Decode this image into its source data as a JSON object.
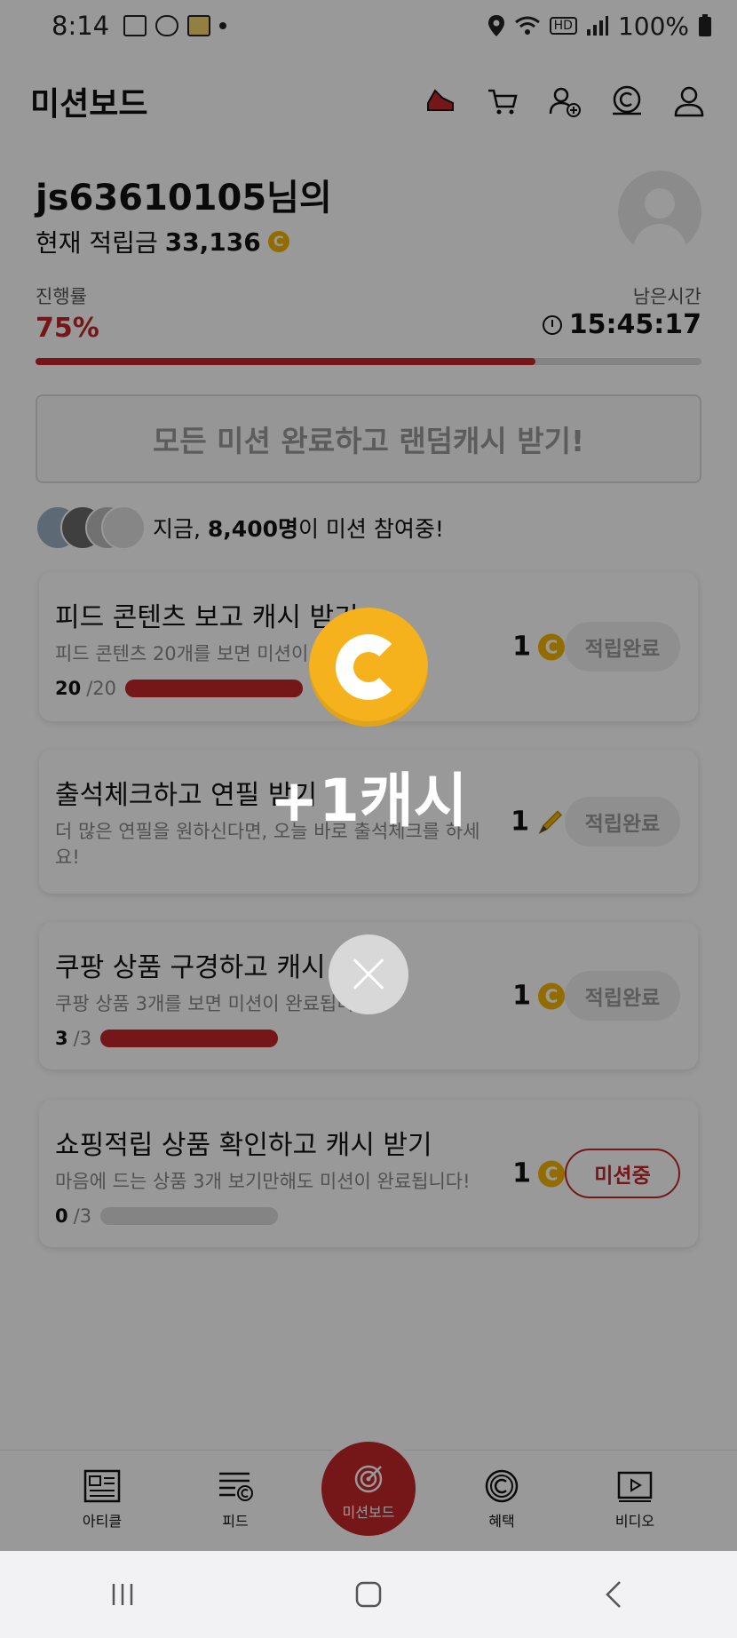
{
  "status_bar": {
    "time": "8:14",
    "battery": "100%",
    "hd_badge": "HD"
  },
  "header": {
    "title": "미션보드",
    "icons": [
      "shoe-icon",
      "cart-icon",
      "add-user-icon",
      "coin-cash-icon",
      "profile-icon"
    ]
  },
  "user": {
    "name": "js63610105님의",
    "balance_label": "현재 적립금",
    "balance_value": "33,136",
    "coin_symbol": "C"
  },
  "progress": {
    "label": "진행률",
    "percent": "75%",
    "percent_value": 0.75,
    "remaining_label": "남은시간",
    "remaining_time": "15:45:17"
  },
  "random_box": {
    "text": "모든 미션 완료하고 랜덤캐시 받기!"
  },
  "participants": {
    "prefix": "지금,",
    "count": "8,400명",
    "suffix": "이 미션 참여중!"
  },
  "missions": [
    {
      "title": "피드 콘텐츠 보고 캐시 받기",
      "desc": "피드 콘텐츠 20개를 보면 미션이 완료됩니다!",
      "done_count": "20",
      "total": "/20",
      "fraction": 1.0,
      "reward": "1",
      "reward_icon": "coin-icon",
      "status": "적립완료"
    },
    {
      "title": "출석체크하고 연필 받기",
      "desc": "더 많은 연필을 원하신다면, 오늘 바로 출석체크를 하세요!",
      "reward": "1",
      "reward_icon": "pencil-icon",
      "status": "적립완료"
    },
    {
      "title": "쿠팡 상품 구경하고 캐시 받기",
      "desc": "쿠팡 상품 3개를 보면 미션이 완료됩니다!",
      "done_count": "3",
      "total": "/3",
      "fraction": 1.0,
      "reward": "1",
      "reward_icon": "coin-icon",
      "status": "적립완료"
    },
    {
      "title": "쇼핑적립 상품 확인하고 캐시 받기",
      "desc": "마음에 드는 상품 3개 보기만해도 미션이 완료됩니다!",
      "done_count": "0",
      "total": "/3",
      "fraction": 0.0,
      "reward": "1",
      "reward_icon": "coin-icon",
      "status": "미션중"
    }
  ],
  "bottom_nav": {
    "items": [
      {
        "label": "아티클",
        "icon": "article-icon"
      },
      {
        "label": "피드",
        "icon": "feed-icon"
      },
      {
        "label": "미션보드",
        "icon": "target-icon"
      },
      {
        "label": "혜택",
        "icon": "benefit-coin-icon"
      },
      {
        "label": "비디오",
        "icon": "video-icon"
      }
    ]
  },
  "popup": {
    "text": "+1캐시",
    "icon": "big-coin-icon"
  },
  "colors": {
    "accent": "#c4262b",
    "coin": "#f5b400"
  }
}
